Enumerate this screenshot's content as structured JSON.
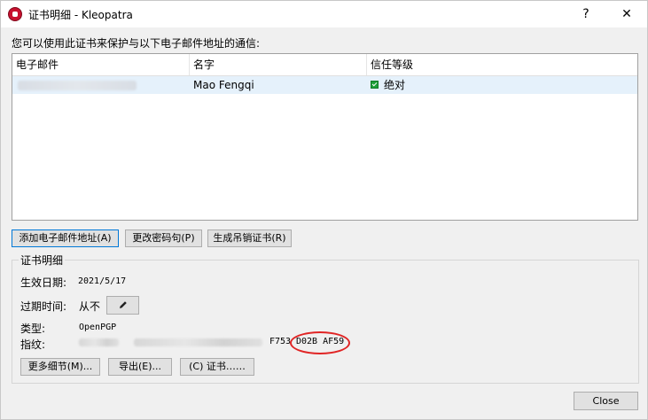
{
  "window": {
    "title": "证书明细 - Kleopatra",
    "help_label": "?",
    "close_label": "✕"
  },
  "intro_text": "您可以使用此证书来保护与以下电子邮件地址的通信:",
  "table": {
    "columns": [
      "电子邮件",
      "名字",
      "信任等级"
    ],
    "rows": [
      {
        "name": "Mao Fengqi",
        "trust": "绝对"
      }
    ]
  },
  "buttons": {
    "add_email": "添加电子邮件地址(A)",
    "change_password": "更改密码句(P)",
    "gen_revoke": "生成吊销证书(R)"
  },
  "details": {
    "group_title": "证书明细",
    "valid_from_label": "生效日期:",
    "valid_from_value": "2021/5/17",
    "expiry_label": "过期时间:",
    "expiry_value": "从不",
    "type_label": "类型:",
    "type_value": "OpenPGP",
    "fingerprint_label": "指纹:",
    "fingerprint_visible": "F753",
    "fingerprint_circled": "D02B AF59",
    "more_details": "更多细节(M)...",
    "export": "导出(E)...",
    "certify": "(C) 证书……"
  },
  "footer": {
    "close_label": "Close"
  },
  "colors": {
    "accent": "#0078d7",
    "row_highlight": "#e5f1fb",
    "annotation": "#e02424",
    "check": "#1e9e36"
  }
}
